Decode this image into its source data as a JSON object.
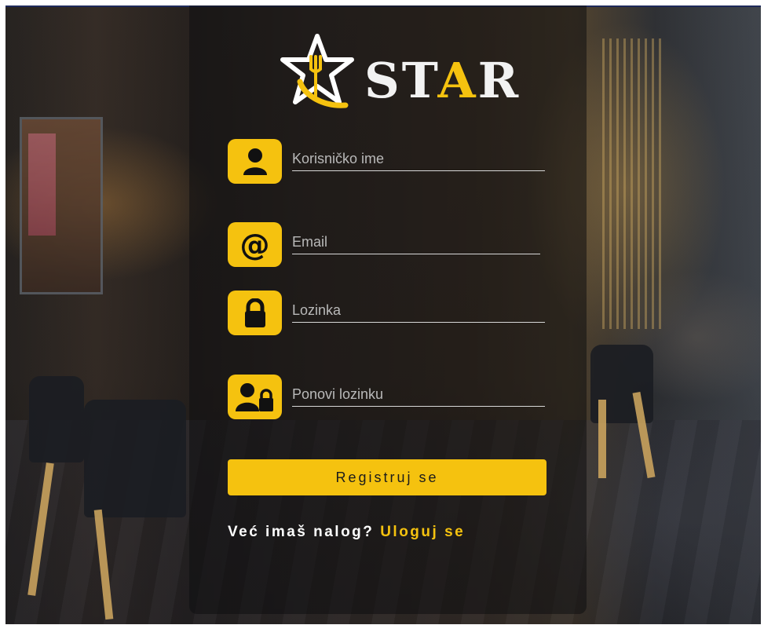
{
  "brand": {
    "name_part1": "ST",
    "name_part2": "A",
    "name_part3": "R"
  },
  "form": {
    "username_placeholder": "Korisničko ime",
    "email_placeholder": "Email",
    "password_placeholder": "Lozinka",
    "repeat_password_placeholder": "Ponovi lozinku",
    "register_label": "Registruj se"
  },
  "footer": {
    "question": "Već imaš nalog?",
    "login_link": "Uloguj se"
  },
  "icons": {
    "username": "user-icon",
    "email": "at-sign-icon",
    "password": "lock-icon",
    "repeat_password": "user-lock-icon",
    "logo": "star-fork-spoon-icon"
  },
  "colors": {
    "accent": "#f5c20f",
    "panel": "rgba(14,14,16,0.55)",
    "text": "#ffffff"
  }
}
